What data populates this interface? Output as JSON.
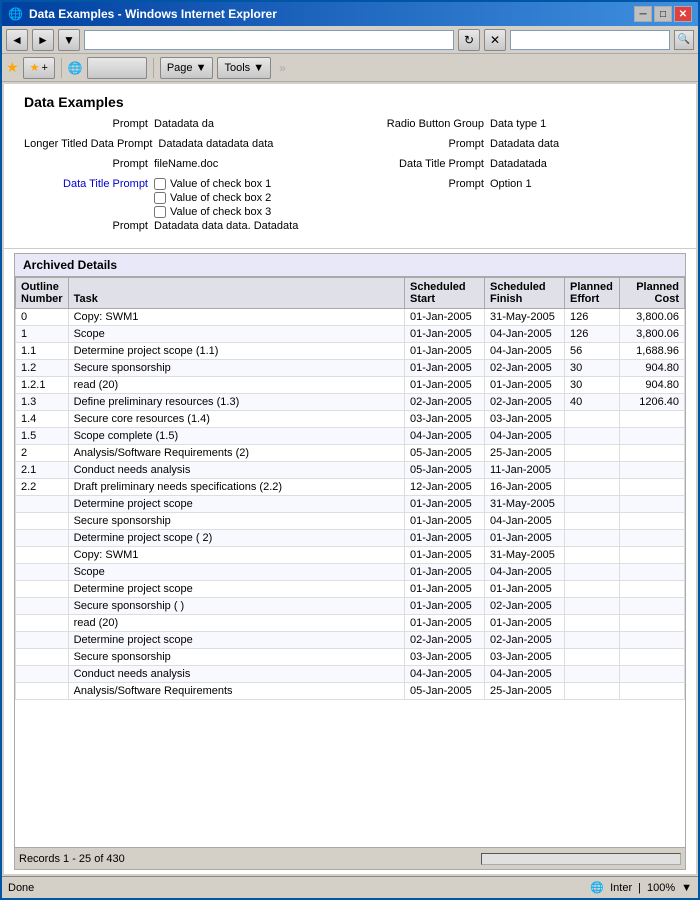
{
  "window": {
    "title": "Data Examples - Windows Internet Explorer",
    "icon": "🌐",
    "controls": {
      "minimize": "─",
      "maximize": "□",
      "close": "✕"
    }
  },
  "address_bar": {
    "back_arrow": "◄",
    "forward_arrow": "►",
    "url_value": "",
    "go_label": "→",
    "refresh": "↻",
    "stop": "✕"
  },
  "toolbar": {
    "favorites_star": "★",
    "add_favorites": "★+",
    "ie_logo": "🌐",
    "blank_btn": "",
    "page_btn": "Page ▼",
    "tools_btn": "Tools ▼"
  },
  "data_examples": {
    "title": "Data Examples",
    "left_fields": [
      {
        "label": "Prompt",
        "value": "Datadata da",
        "label_style": "normal"
      },
      {
        "label": "Longer Titled Data Prompt",
        "value": "Datadata datadata data",
        "label_style": "normal"
      },
      {
        "label": "Prompt",
        "value": "fileName.doc",
        "label_style": "normal"
      },
      {
        "label": "Data Title Prompt",
        "value": "",
        "label_style": "blue",
        "type": "checkboxes",
        "checkboxes": [
          {
            "label": "Value of check box 1",
            "checked": false
          },
          {
            "label": "Value of check box 2",
            "checked": false
          },
          {
            "label": "Value of check box 3",
            "checked": false
          }
        ]
      },
      {
        "label": "Prompt",
        "value": "Datadata data data. Datadata",
        "label_style": "normal"
      }
    ],
    "right_fields": [
      {
        "label": "Radio Button Group",
        "value": "Data type 1",
        "label_style": "normal"
      },
      {
        "label": "Prompt",
        "value": "Datadata data",
        "label_style": "normal"
      },
      {
        "label": "Data Title Prompt",
        "value": "Datadatada",
        "label_style": "normal"
      },
      {
        "label": "Prompt",
        "value": "Option 1",
        "label_style": "normal"
      }
    ]
  },
  "archived_details": {
    "title": "Archived Details",
    "columns": [
      {
        "id": "outline",
        "label": "Outline\nNumber"
      },
      {
        "id": "task",
        "label": "Task"
      },
      {
        "id": "sched_start",
        "label": "Scheduled\nStart"
      },
      {
        "id": "sched_finish",
        "label": "Scheduled\nFinish"
      },
      {
        "id": "planned_effort",
        "label": "Planned\nEffort"
      },
      {
        "id": "planned_cost",
        "label": "Planned\nCost"
      }
    ],
    "rows": [
      {
        "outline": "0",
        "task": "Copy: SWM1",
        "sched_start": "01-Jan-2005",
        "sched_finish": "31-May-2005",
        "planned_effort": "126",
        "planned_cost": "3,800.06"
      },
      {
        "outline": "1",
        "task": "Scope",
        "sched_start": "01-Jan-2005",
        "sched_finish": "04-Jan-2005",
        "planned_effort": "126",
        "planned_cost": "3,800.06"
      },
      {
        "outline": "1.1",
        "task": "Determine project scope (1.1)",
        "sched_start": "01-Jan-2005",
        "sched_finish": "04-Jan-2005",
        "planned_effort": "56",
        "planned_cost": "1,688.96"
      },
      {
        "outline": "1.2",
        "task": "Secure sponsorship",
        "sched_start": "01-Jan-2005",
        "sched_finish": "02-Jan-2005",
        "planned_effort": "30",
        "planned_cost": "904.80"
      },
      {
        "outline": "1.2.1",
        "task": "read (20)",
        "sched_start": "01-Jan-2005",
        "sched_finish": "01-Jan-2005",
        "planned_effort": "30",
        "planned_cost": "904.80"
      },
      {
        "outline": "1.3",
        "task": "Define preliminary resources (1.3)",
        "sched_start": "02-Jan-2005",
        "sched_finish": "02-Jan-2005",
        "planned_effort": "40",
        "planned_cost": "1206.40"
      },
      {
        "outline": "1.4",
        "task": "Secure core resources (1.4)",
        "sched_start": "03-Jan-2005",
        "sched_finish": "03-Jan-2005",
        "planned_effort": "",
        "planned_cost": ""
      },
      {
        "outline": "1.5",
        "task": "Scope complete (1.5)",
        "sched_start": "04-Jan-2005",
        "sched_finish": "04-Jan-2005",
        "planned_effort": "",
        "planned_cost": ""
      },
      {
        "outline": "2",
        "task": "Analysis/Software Requirements (2)",
        "sched_start": "05-Jan-2005",
        "sched_finish": "25-Jan-2005",
        "planned_effort": "",
        "planned_cost": ""
      },
      {
        "outline": "2.1",
        "task": "Conduct needs analysis",
        "sched_start": "05-Jan-2005",
        "sched_finish": "11-Jan-2005",
        "planned_effort": "",
        "planned_cost": ""
      },
      {
        "outline": "2.2",
        "task": "Draft preliminary needs specifications (2.2)",
        "sched_start": "12-Jan-2005",
        "sched_finish": "16-Jan-2005",
        "planned_effort": "",
        "planned_cost": ""
      },
      {
        "outline": "",
        "task": "Determine project scope",
        "sched_start": "01-Jan-2005",
        "sched_finish": "31-May-2005",
        "planned_effort": "",
        "planned_cost": ""
      },
      {
        "outline": "",
        "task": "Secure sponsorship",
        "sched_start": "01-Jan-2005",
        "sched_finish": "04-Jan-2005",
        "planned_effort": "",
        "planned_cost": ""
      },
      {
        "outline": "",
        "task": "Determine project scope (  2)",
        "sched_start": "01-Jan-2005",
        "sched_finish": "01-Jan-2005",
        "planned_effort": "",
        "planned_cost": ""
      },
      {
        "outline": "",
        "task": "Copy: SWM1",
        "sched_start": "01-Jan-2005",
        "sched_finish": "31-May-2005",
        "planned_effort": "",
        "planned_cost": ""
      },
      {
        "outline": "",
        "task": "Scope",
        "sched_start": "01-Jan-2005",
        "sched_finish": "04-Jan-2005",
        "planned_effort": "",
        "planned_cost": ""
      },
      {
        "outline": "",
        "task": "Determine project scope",
        "sched_start": "01-Jan-2005",
        "sched_finish": "01-Jan-2005",
        "planned_effort": "",
        "planned_cost": ""
      },
      {
        "outline": "",
        "task": "Secure sponsorship (    )",
        "sched_start": "01-Jan-2005",
        "sched_finish": "02-Jan-2005",
        "planned_effort": "",
        "planned_cost": ""
      },
      {
        "outline": "",
        "task": "read (20)",
        "sched_start": "01-Jan-2005",
        "sched_finish": "01-Jan-2005",
        "planned_effort": "",
        "planned_cost": ""
      },
      {
        "outline": "",
        "task": "Determine project scope",
        "sched_start": "02-Jan-2005",
        "sched_finish": "02-Jan-2005",
        "planned_effort": "",
        "planned_cost": ""
      },
      {
        "outline": "",
        "task": "Secure sponsorship",
        "sched_start": "03-Jan-2005",
        "sched_finish": "03-Jan-2005",
        "planned_effort": "",
        "planned_cost": ""
      },
      {
        "outline": "",
        "task": "Conduct needs analysis",
        "sched_start": "04-Jan-2005",
        "sched_finish": "04-Jan-2005",
        "planned_effort": "",
        "planned_cost": ""
      },
      {
        "outline": "",
        "task": "Analysis/Software Requirements",
        "sched_start": "05-Jan-2005",
        "sched_finish": "25-Jan-2005",
        "planned_effort": "",
        "planned_cost": ""
      }
    ],
    "records_info": "Records 1 - 25 of 430"
  },
  "status_bar": {
    "done": "Done",
    "internet": "Inter",
    "zoom": "100%"
  }
}
